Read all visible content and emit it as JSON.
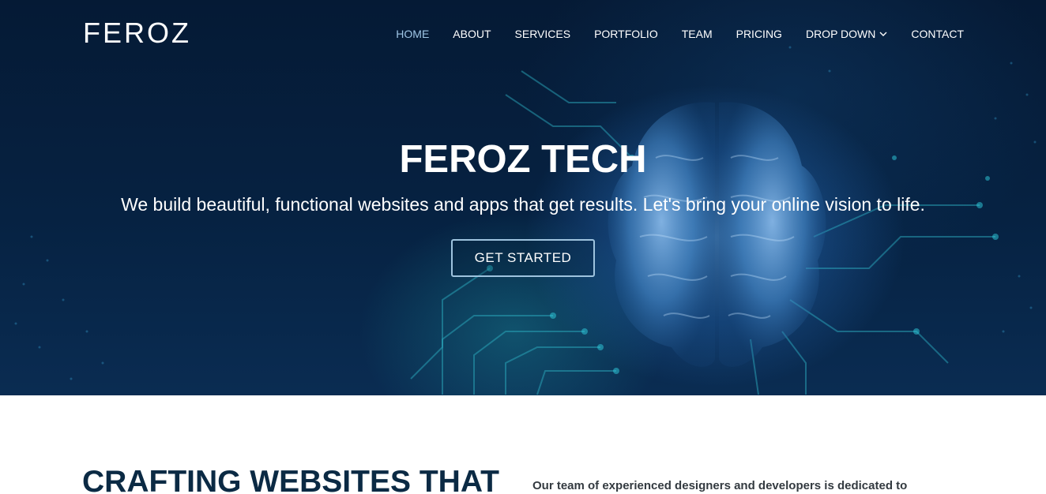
{
  "header": {
    "logo": "FEROZ",
    "nav": [
      {
        "label": "HOME",
        "active": true
      },
      {
        "label": "ABOUT"
      },
      {
        "label": "SERVICES"
      },
      {
        "label": "PORTFOLIO"
      },
      {
        "label": "TEAM"
      },
      {
        "label": "PRICING"
      },
      {
        "label": "DROP DOWN",
        "icon": "chevron-down-icon"
      },
      {
        "label": "CONTACT"
      }
    ]
  },
  "hero": {
    "title": "FEROZ TECH",
    "subtitle": "We build beautiful, functional websites and apps that get results. Let's bring your online vision to life.",
    "cta_label": "GET STARTED",
    "background_image": "brain-circuit-illustration"
  },
  "about": {
    "heading": "CRAFTING WEBSITES THAT",
    "text": "Our team of experienced designers and developers is dedicated to"
  },
  "colors": {
    "hero_bg": "#062242",
    "nav_active": "#9fc6e6",
    "heading_dark": "#0b2a44",
    "button_border": "#9ec3de"
  }
}
